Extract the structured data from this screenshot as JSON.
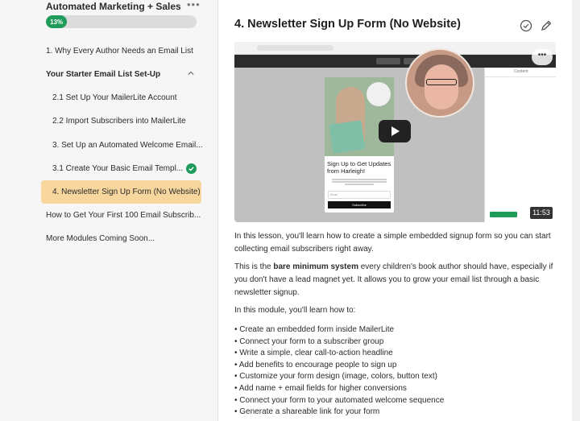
{
  "sidebar": {
    "course_title": "Automated Marketing + Sales",
    "more_label": "•••",
    "progress": {
      "label": "13%",
      "value": 13
    },
    "items": [
      {
        "label": "1. Why Every Author Needs an Email List"
      },
      {
        "label": "Your Starter Email List Set-Up"
      },
      {
        "label": "2.1 Set Up Your MailerLite Account"
      },
      {
        "label": "2.2 Import Subscribers into MailerLite"
      },
      {
        "label": "3. Set Up an Automated Welcome Email..."
      },
      {
        "label": "3.1 Create Your Basic Email Templ..."
      },
      {
        "label": "4. Newsletter Sign Up Form (No Website)"
      },
      {
        "label": "How to Get Your First 100 Email Subscrib..."
      },
      {
        "label": "More Modules Coming Soon..."
      }
    ]
  },
  "main": {
    "title": "4. Newsletter Sign Up Form (No Website)",
    "video": {
      "duration": "11:53",
      "menu_label": "•••",
      "panel_label": "Content",
      "card_heading": "Sign Up to Get Updates from Harleigh!",
      "card_input": "Email",
      "card_button": "Subscribe"
    },
    "intro": "In this lesson, you'll learn how to create a simple embedded signup form so you can start collecting email subscribers right away.",
    "para2_pre": "This is the ",
    "para2_bold": "bare minimum system",
    "para2_post": " every children's book author should have, especially if you don't have a lead magnet yet. It allows you to grow your email list through a basic newsletter signup.",
    "para3": "In this module, you'll learn how to:",
    "bullets": [
      "• Create an embedded form inside MailerLite",
      "• Connect your form to a subscriber group",
      "• Write a simple, clear call-to-action headline",
      "• Add benefits to encourage people to sign up",
      "• Customize your form design (image, colors, button text)",
      "• Add name + email fields for higher conversions",
      "• Connect your form to your automated welcome sequence",
      "• Generate a shareable link for your form"
    ]
  },
  "colors": {
    "accent_green": "#1f9b5a",
    "active_highlight": "#f7d79e"
  }
}
